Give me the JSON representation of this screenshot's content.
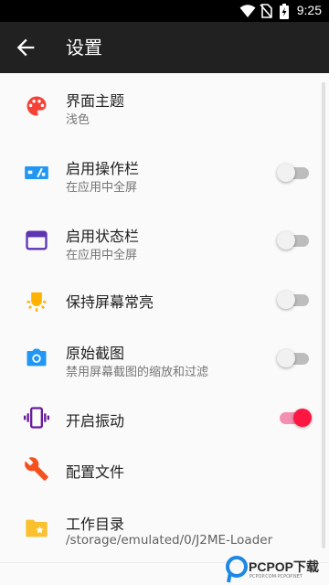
{
  "status_bar": {
    "time": "9:25"
  },
  "app_bar": {
    "title": "设置",
    "back_icon": "arrow-back-icon"
  },
  "settings": [
    {
      "icon": "palette-icon",
      "icon_color": "#f44336",
      "title": "界面主题",
      "summary": "浅色"
    },
    {
      "icon": "fullscreen-toggle-icon",
      "icon_color": "#2196f3",
      "title": "启用操作栏",
      "summary": "在应用中全屏",
      "toggle": false
    },
    {
      "icon": "window-icon",
      "icon_color": "#5e35b1",
      "title": "启用状态栏",
      "summary": "在应用中全屏",
      "toggle": false
    },
    {
      "icon": "brightness-icon",
      "icon_color": "#ffb300",
      "title": "保持屏幕常亮",
      "toggle": false
    },
    {
      "icon": "camera-icon",
      "icon_color": "#2196f3",
      "title": "原始截图",
      "summary": "禁用屏幕截图的缩放和过滤",
      "toggle": false
    },
    {
      "icon": "vibration-icon",
      "icon_color": "#6a1b9a",
      "title": "开启振动",
      "toggle": true
    },
    {
      "icon": "wrench-icon",
      "icon_color": "#f4511e",
      "title": "配置文件"
    },
    {
      "icon": "folder-star-icon",
      "icon_color": "#fbc02d",
      "title": "工作目录",
      "summary": "/storage/emulated/0/J2ME-Loader"
    }
  ],
  "watermark": {
    "text": "PCPOP下载",
    "sub": "PCPOP.COM·PCPOP.NET"
  },
  "colors": {
    "accent": "#ff1744",
    "appbar": "#212121"
  }
}
